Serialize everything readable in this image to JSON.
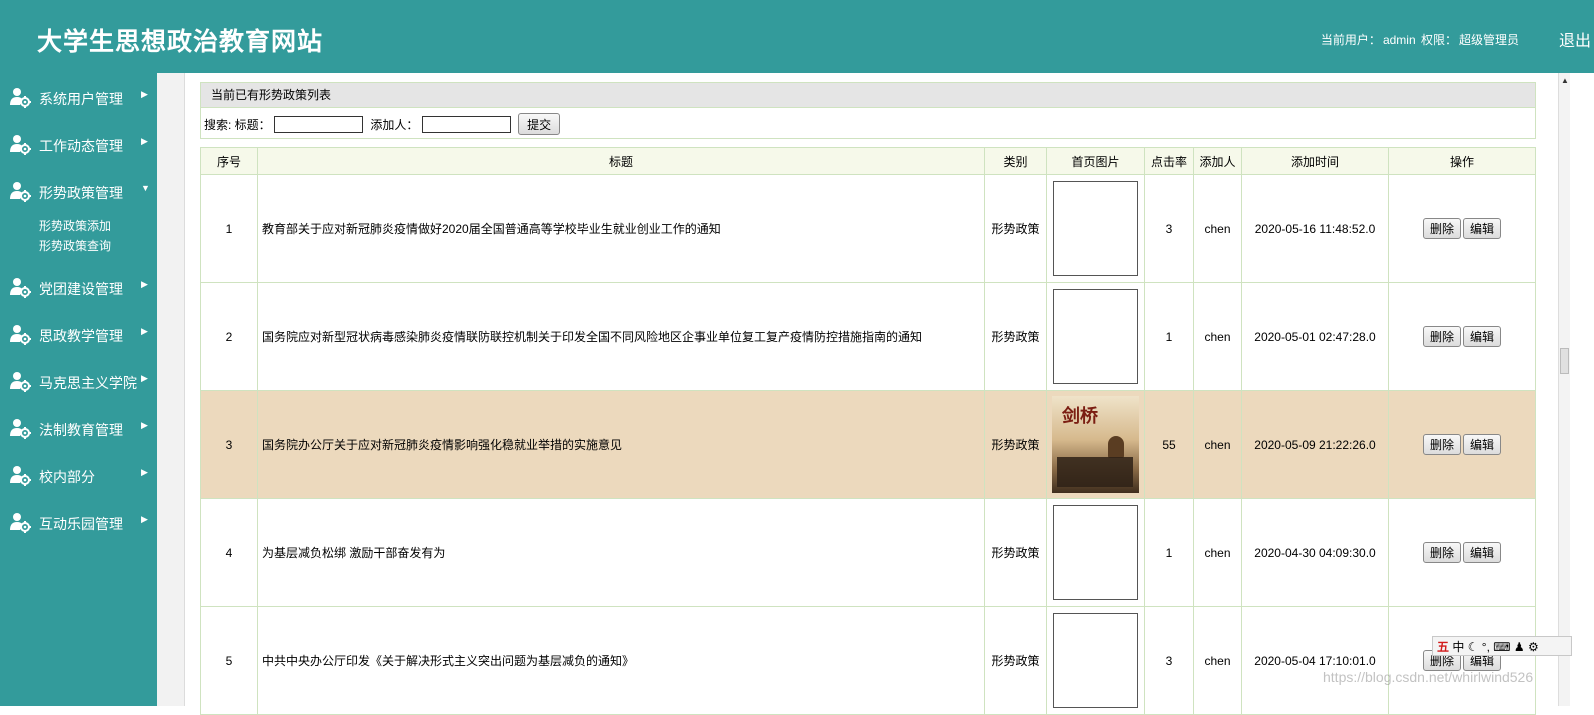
{
  "header": {
    "site_title": "大学生思想政治教育网站",
    "current_user_label": "当前用户：",
    "current_user": "admin",
    "role_label": "权限：",
    "role": "超级管理员",
    "logout": "退出",
    "bg_color": "#339b9b"
  },
  "sidebar": {
    "items": [
      {
        "label": "系统用户管理",
        "icon": "user-gear-icon",
        "expanded": false
      },
      {
        "label": "工作动态管理",
        "icon": "user-gear-icon",
        "expanded": false
      },
      {
        "label": "形势政策管理",
        "icon": "user-gear-icon",
        "expanded": true,
        "children": [
          "形势政策添加",
          "形势政策查询"
        ]
      },
      {
        "label": "党团建设管理",
        "icon": "user-gear-icon",
        "expanded": false
      },
      {
        "label": "思政教学管理",
        "icon": "user-gear-icon",
        "expanded": false
      },
      {
        "label": "马克思主义学院",
        "icon": "user-gear-icon",
        "expanded": false
      },
      {
        "label": "法制教育管理",
        "icon": "user-gear-icon",
        "expanded": false
      },
      {
        "label": "校内部分",
        "icon": "user-gear-icon",
        "expanded": false
      },
      {
        "label": "互动乐园管理",
        "icon": "user-gear-icon",
        "expanded": false
      }
    ]
  },
  "panel": {
    "title": "当前已有形势政策列表",
    "search_prefix": "搜索: 标题：",
    "adder_label": "添加人：",
    "title_value": "",
    "adder_value": "",
    "submit": "提交"
  },
  "table": {
    "columns": [
      "序号",
      "标题",
      "类别",
      "首页图片",
      "点击率",
      "添加人",
      "添加时间",
      "操作"
    ],
    "rows": [
      {
        "no": "1",
        "title": "教育部关于应对新冠肺炎疫情做好2020届全国普通高等学校毕业生就业创业工作的通知",
        "category": "形势政策",
        "has_image": false,
        "clicks": "3",
        "adder": "chen",
        "time": "2020-05-16 11:48:52.0",
        "highlighted": false
      },
      {
        "no": "2",
        "title": "国务院应对新型冠状病毒感染肺炎疫情联防联控机制关于印发全国不同风险地区企事业单位复工复产疫情防控措施指南的通知",
        "category": "形势政策",
        "has_image": false,
        "clicks": "1",
        "adder": "chen",
        "time": "2020-05-01 02:47:28.0",
        "highlighted": false
      },
      {
        "no": "3",
        "title": "国务院办公厅关于应对新冠肺炎疫情影响强化稳就业举措的实施意见",
        "category": "形势政策",
        "has_image": true,
        "image_text": "剑桥",
        "clicks": "55",
        "adder": "chen",
        "time": "2020-05-09 21:22:26.0",
        "highlighted": true
      },
      {
        "no": "4",
        "title": "为基层减负松绑 激励干部奋发有为",
        "category": "形势政策",
        "has_image": false,
        "clicks": "1",
        "adder": "chen",
        "time": "2020-04-30 04:09:30.0",
        "highlighted": false
      },
      {
        "no": "5",
        "title": "中共中央办公厅印发《关于解决形式主义突出问题为基层减负的通知》",
        "category": "形势政策",
        "has_image": false,
        "clicks": "3",
        "adder": "chen",
        "time": "2020-05-04 17:10:01.0",
        "highlighted": false
      }
    ],
    "actions": {
      "delete": "删除",
      "edit": "编辑"
    }
  },
  "ime": {
    "logo": "五",
    "mode": "中",
    "extras": "☾ °, ⌨ ♟ ⚙"
  },
  "watermark": "https://blog.csdn.net/whirlwind526"
}
